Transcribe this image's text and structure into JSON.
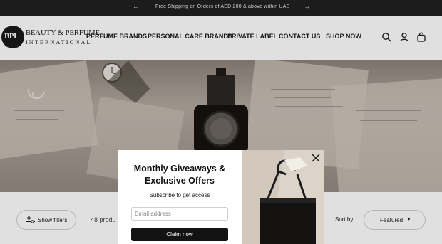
{
  "announcement": {
    "message": "Free Shipping on Orders of AED 200 & above within UAE",
    "prev_icon": "chevron-left-icon",
    "next_icon": "chevron-right-icon"
  },
  "header": {
    "logo": {
      "monogram": "BPI",
      "line1": "BEAUTY & PERFUME",
      "line2": "INTERNATIONAL"
    },
    "nav": [
      {
        "label": "PERFUME BRANDS"
      },
      {
        "label": "PERSONAL CARE BRANDS"
      },
      {
        "label": "PRIVATE LABEL"
      },
      {
        "label": "CONTACT US"
      },
      {
        "label": "SHOP NOW"
      }
    ],
    "icons": [
      "search-icon",
      "account-icon",
      "cart-icon"
    ]
  },
  "collection": {
    "filter_label": "Show filters",
    "product_count": "48 produ",
    "sort_label": "Sort by:",
    "sort_value": "Featured"
  },
  "popup": {
    "title": "Monthly Giveaways & Exclusive Offers",
    "subtitle": "Subscribe to get access",
    "email_placeholder": "Email address",
    "email_value": "",
    "cta": "Claim now"
  },
  "colors": {
    "dark": "#1c1c1c",
    "button": "#121212",
    "hero_tone": "#a39a91"
  }
}
